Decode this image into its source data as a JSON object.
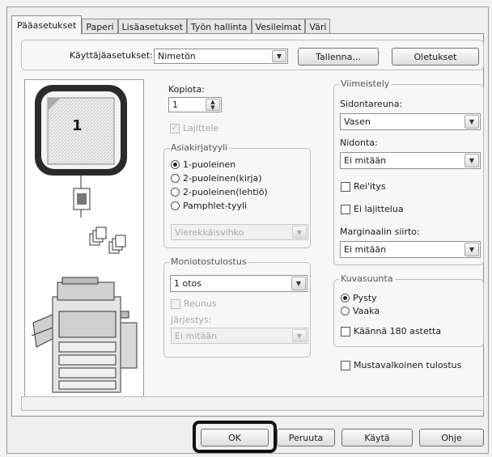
{
  "tabs": [
    "Pääasetukset",
    "Paperi",
    "Lisäasetukset",
    "Työn hallinta",
    "Vesileimat",
    "Väri"
  ],
  "user_settings": {
    "label": "Käyttäjäasetukset:",
    "value": "Nimetön",
    "save_label": "Tallenna...",
    "defaults_label": "Oletukset"
  },
  "preview": {
    "page_number": "1"
  },
  "copies": {
    "label": "Kopiota:",
    "value": "1",
    "collate_label": "Lajittele",
    "collate_checked": true
  },
  "document_style": {
    "title": "Asiakirjatyyli",
    "options": [
      "1-puoleinen",
      "2-puoleinen(kirja)",
      "2-puoleinen(lehtiö)",
      "Pamphlet-tyyli"
    ],
    "selected_index": 0,
    "pamphlet_select": "Vierekkäisvihko"
  },
  "multi_print": {
    "title": "Moniotostulostus",
    "value": "1 otos",
    "border_label": "Reunus",
    "order_label": "Järjestys:",
    "order_value": "Ei mitään"
  },
  "finishing": {
    "title": "Viimeistely",
    "binding_edge_label": "Sidontareuna:",
    "binding_edge_value": "Vasen",
    "staple_label": "Nidonta:",
    "staple_value": "Ei mitään",
    "punch_label": "Rei'itys",
    "no_offset_label": "Ei lajittelua",
    "margin_shift_label": "Marginaalin siirto:",
    "margin_shift_value": "Ei mitään"
  },
  "orientation": {
    "title": "Kuvasuunta",
    "options": [
      "Pysty",
      "Vaaka"
    ],
    "selected_index": 0,
    "rotate_label": "Käännä 180 astetta"
  },
  "bw_print_label": "Mustavalkoinen tulostus",
  "buttons": {
    "ok": "OK",
    "cancel": "Peruuta",
    "apply": "Käytä",
    "help": "Ohje"
  }
}
